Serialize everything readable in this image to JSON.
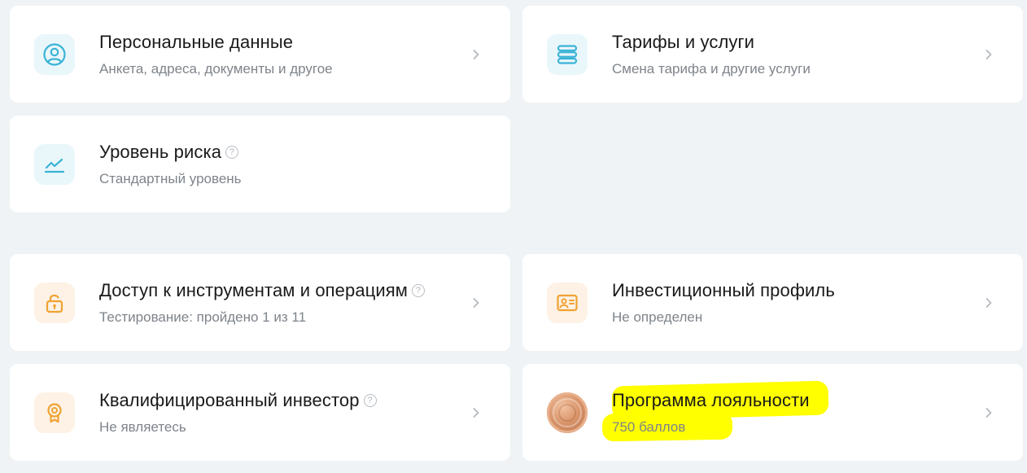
{
  "cards": {
    "personal": {
      "title": "Персональные данные",
      "subtitle": "Анкета, адреса, документы и другое",
      "icon": "user-circle-icon"
    },
    "tariffs": {
      "title": "Тарифы и услуги",
      "subtitle": "Смена тарифа и другие услуги",
      "icon": "stack-icon"
    },
    "risk": {
      "title": "Уровень риска",
      "subtitle": "Стандартный уровень",
      "icon": "chart-line-icon",
      "help": "?"
    },
    "access": {
      "title": "Доступ к инструментам и операциям",
      "subtitle": "Тестирование: пройдено 1 из 11",
      "icon": "unlock-icon",
      "help": "?"
    },
    "profile": {
      "title": "Инвестиционный профиль",
      "subtitle": "Не определен",
      "icon": "id-card-icon"
    },
    "qualified": {
      "title": "Квалифицированный инвестор",
      "subtitle": "Не являетесь",
      "icon": "award-icon",
      "help": "?"
    },
    "loyalty": {
      "title": "Программа лояльности",
      "subtitle": "750 баллов",
      "icon": "bronze-coin-icon"
    }
  },
  "colors": {
    "background": "#f0f3f5",
    "card": "#ffffff",
    "accent_blue": "#3bb3d6",
    "accent_orange": "#f0a233",
    "highlight": "#ffff00",
    "title": "#1a1a1a",
    "subtitle": "#7e848b"
  }
}
